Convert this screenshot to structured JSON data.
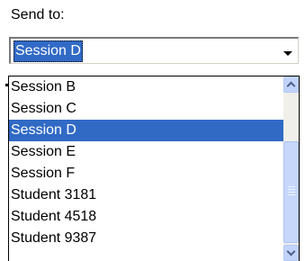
{
  "send_to": {
    "label": "Send to:",
    "selected_value": "Session D"
  },
  "list": {
    "items": [
      {
        "label": "Session B",
        "selected": false
      },
      {
        "label": "Session C",
        "selected": false
      },
      {
        "label": "Session D",
        "selected": true
      },
      {
        "label": "Session E",
        "selected": false
      },
      {
        "label": "Session F",
        "selected": false
      },
      {
        "label": "Student 3181",
        "selected": false
      },
      {
        "label": "Student 4518",
        "selected": false
      },
      {
        "label": "Student 9387",
        "selected": false
      }
    ]
  },
  "icons": {
    "dropdown": "chevron-down-icon",
    "scroll_up": "chevron-up-icon",
    "scroll_down": "chevron-down-icon"
  },
  "colors": {
    "selection": "#316ac5",
    "selection_text": "#ffffff",
    "scrollbar_track": "#f0efe9",
    "scrollbar_thumb": "#c6d7fb"
  }
}
